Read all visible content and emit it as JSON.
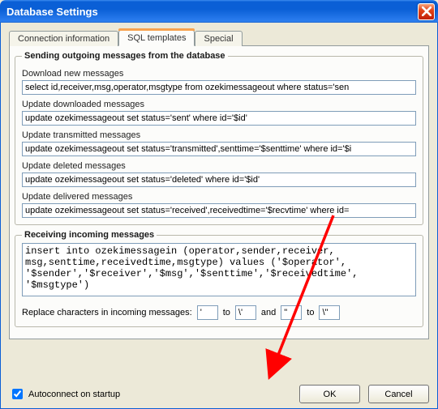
{
  "window": {
    "title": "Database Settings"
  },
  "tabs": {
    "connection": "Connection information",
    "sql": "SQL templates",
    "special": "Special"
  },
  "outgoing": {
    "legend": "Sending outgoing messages from the database",
    "download_label": "Download new messages",
    "download_sql": "select id,receiver,msg,operator,msgtype from ozekimessageout where status='sen",
    "update_downloaded_label": "Update downloaded messages",
    "update_downloaded_sql": "update ozekimessageout set status='sent' where id='$id'",
    "update_transmitted_label": "Update transmitted messages",
    "update_transmitted_sql": "update ozekimessageout set status='transmitted',senttime='$senttime' where id='$i",
    "update_deleted_label": "Update deleted messages",
    "update_deleted_sql": "update ozekimessageout set status='deleted' where id='$id'",
    "update_delivered_label": "Update delivered messages",
    "update_delivered_sql": "update ozekimessageout set status='received',receivedtime='$recvtime' where id="
  },
  "incoming": {
    "legend": "Receiving incoming messages",
    "insert_sql": "insert into ozekimessagein (operator,sender,receiver,\nmsg,senttime,receivedtime,msgtype) values ('$operator',\n'$sender','$receiver','$msg','$senttime','$receivedtime',\n'$msgtype')",
    "replace_label": "Replace characters in incoming messages:",
    "to_label": "to",
    "and_label": "and",
    "r1_from": "'",
    "r1_to": "\\'",
    "r2_from": "\"",
    "r2_to": "\\\""
  },
  "footer": {
    "autoconnect_label": "Autoconnect on startup",
    "ok": "OK",
    "cancel": "Cancel"
  }
}
